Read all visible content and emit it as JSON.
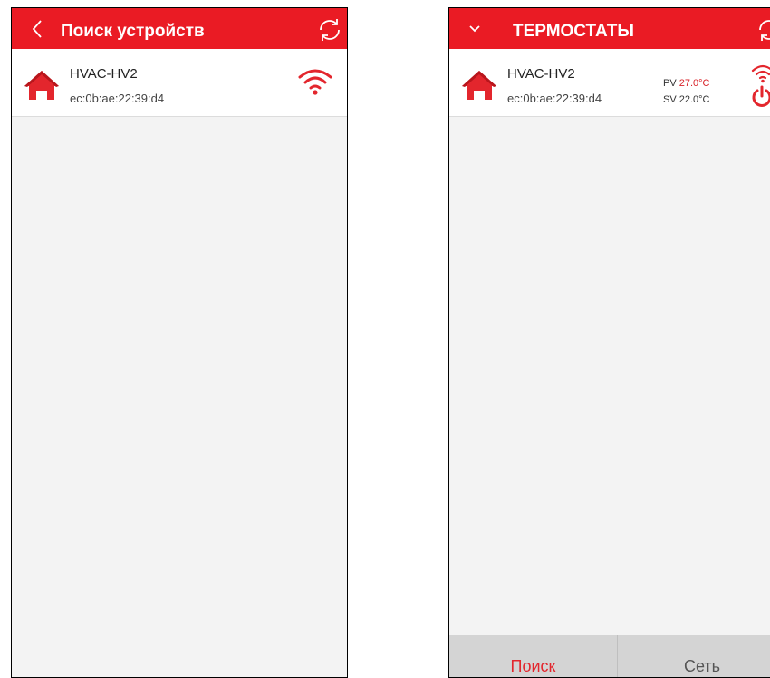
{
  "left_screen": {
    "title": "Поиск устройств",
    "device": {
      "name": "HVAC-HV2",
      "mac": "ec:0b:ae:22:39:d4"
    }
  },
  "right_screen": {
    "title": "ТЕРМОСТАТЫ",
    "device": {
      "name": "HVAC-HV2",
      "mac": "ec:0b:ae:22:39:d4",
      "pv_label": "PV",
      "pv_value": "27.0°C",
      "sv_label": "SV",
      "sv_value": "22.0°C"
    },
    "tabs": {
      "search": "Поиск",
      "network": "Сеть"
    }
  },
  "colors": {
    "accent": "#ea1b24",
    "background": "#f3f3f3",
    "tab_bar": "#d4d4d4"
  },
  "icons": [
    "chevron-left-icon",
    "chevron-down-icon",
    "refresh-icon",
    "home-icon",
    "wifi-icon",
    "power-icon"
  ]
}
